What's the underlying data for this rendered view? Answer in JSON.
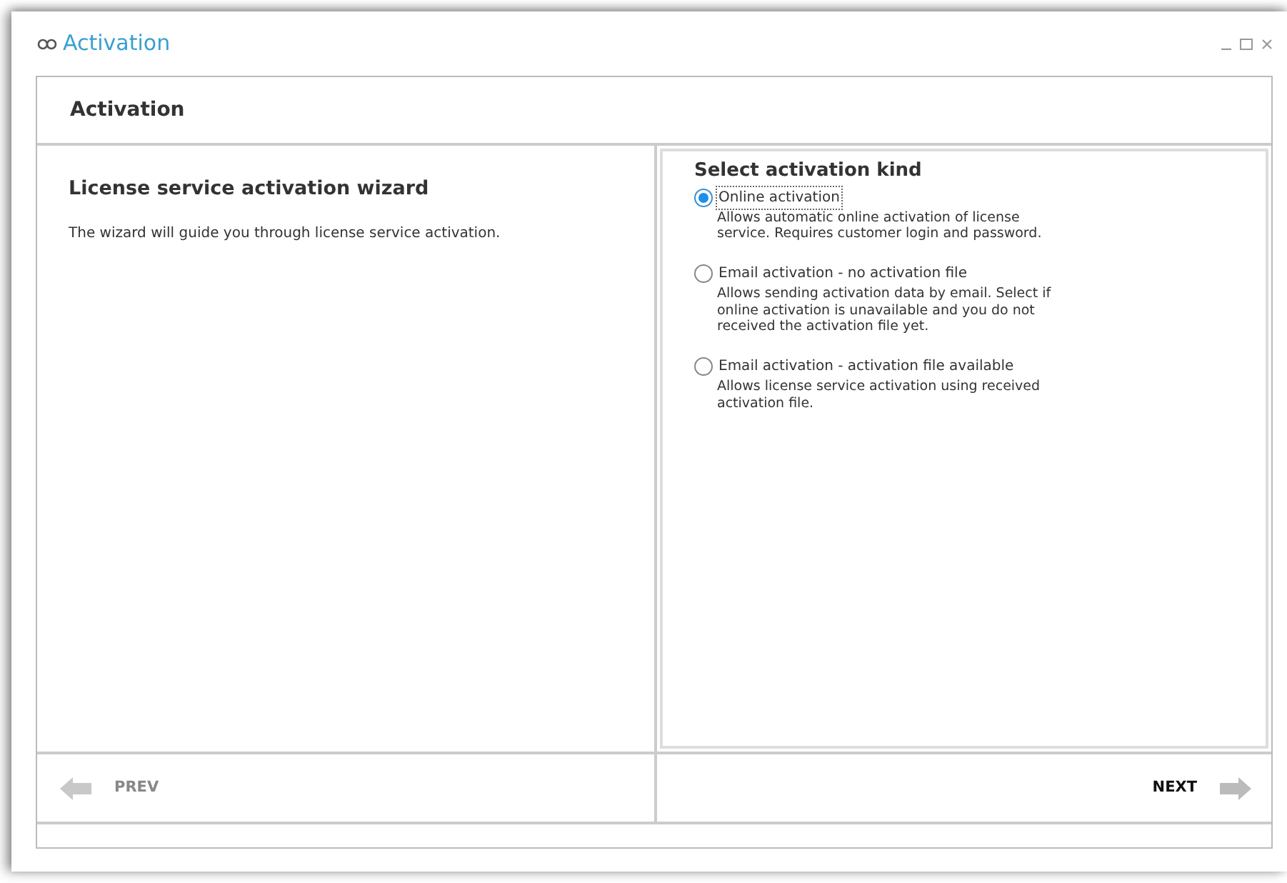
{
  "window": {
    "title": "Activation"
  },
  "header": {
    "title": "Activation"
  },
  "left_panel": {
    "title": "License service activation wizard",
    "text": "The wizard will guide you through license service activation."
  },
  "right_panel": {
    "title": "Select activation kind",
    "options": [
      {
        "label": "Online activation",
        "description": "Allows automatic online activation of license service. Requires customer login and  password.",
        "selected": true
      },
      {
        "label": "Email activation - no activation file",
        "description": "Allows sending activation data by email. Select if online activation is unavailable and you do not received the activation file yet.",
        "selected": false
      },
      {
        "label": "Email activation - activation file available",
        "description": "Allows license service activation using received activation file.",
        "selected": false
      }
    ]
  },
  "navigation": {
    "prev": {
      "label": "PREV",
      "disabled": true
    },
    "next": {
      "label": "NEXT",
      "disabled": false
    }
  }
}
